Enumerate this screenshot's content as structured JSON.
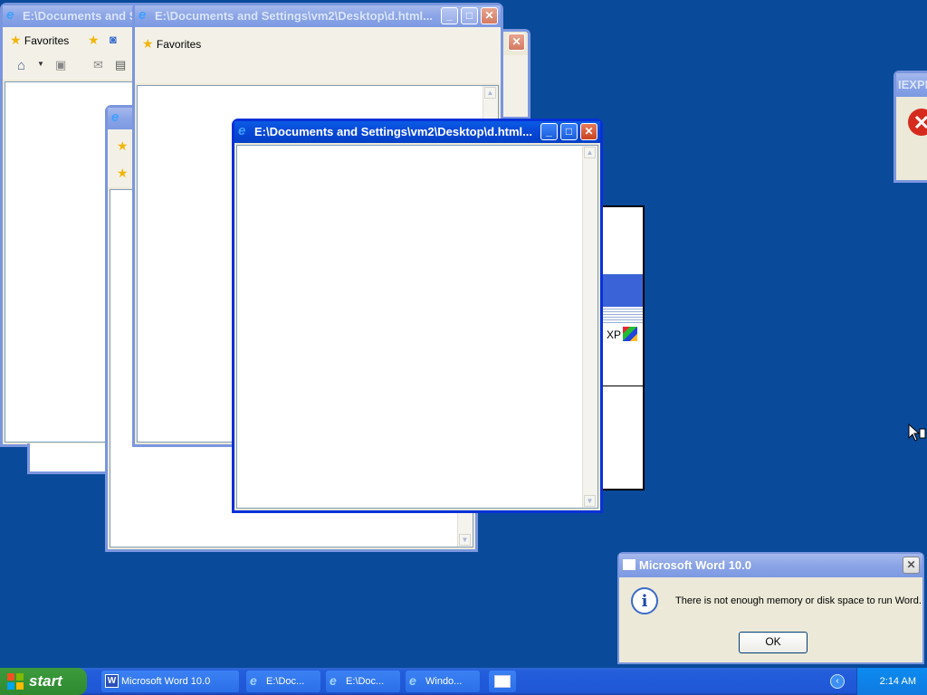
{
  "windows": {
    "w1_title": "E:\\Documents and Se",
    "w2_title": "E:\\Documents and Settings\\vm2\\Desktop\\d.html...",
    "w4_title": "E:\\Documents and Settings\\vm2\\Desktop\\d.html...",
    "favorites_label": "Favorites",
    "right_peek_title": "IEXPLO"
  },
  "background_panel": {
    "xp_text": "XP"
  },
  "dialog": {
    "title": "Microsoft Word 10.0",
    "message": "There is not enough memory or disk space to run Word.",
    "ok_label": "OK"
  },
  "taskbar": {
    "start_label": "start",
    "items": [
      {
        "label": "Microsoft Word 10.0"
      },
      {
        "label": "E:\\Doc..."
      },
      {
        "label": "E:\\Doc..."
      },
      {
        "label": "Windo..."
      }
    ],
    "clock": "2:14 AM"
  },
  "colors": {
    "desktop": "#0a4a9a",
    "title_active": "#0848d8",
    "title_inactive": "#8aa4e6"
  }
}
